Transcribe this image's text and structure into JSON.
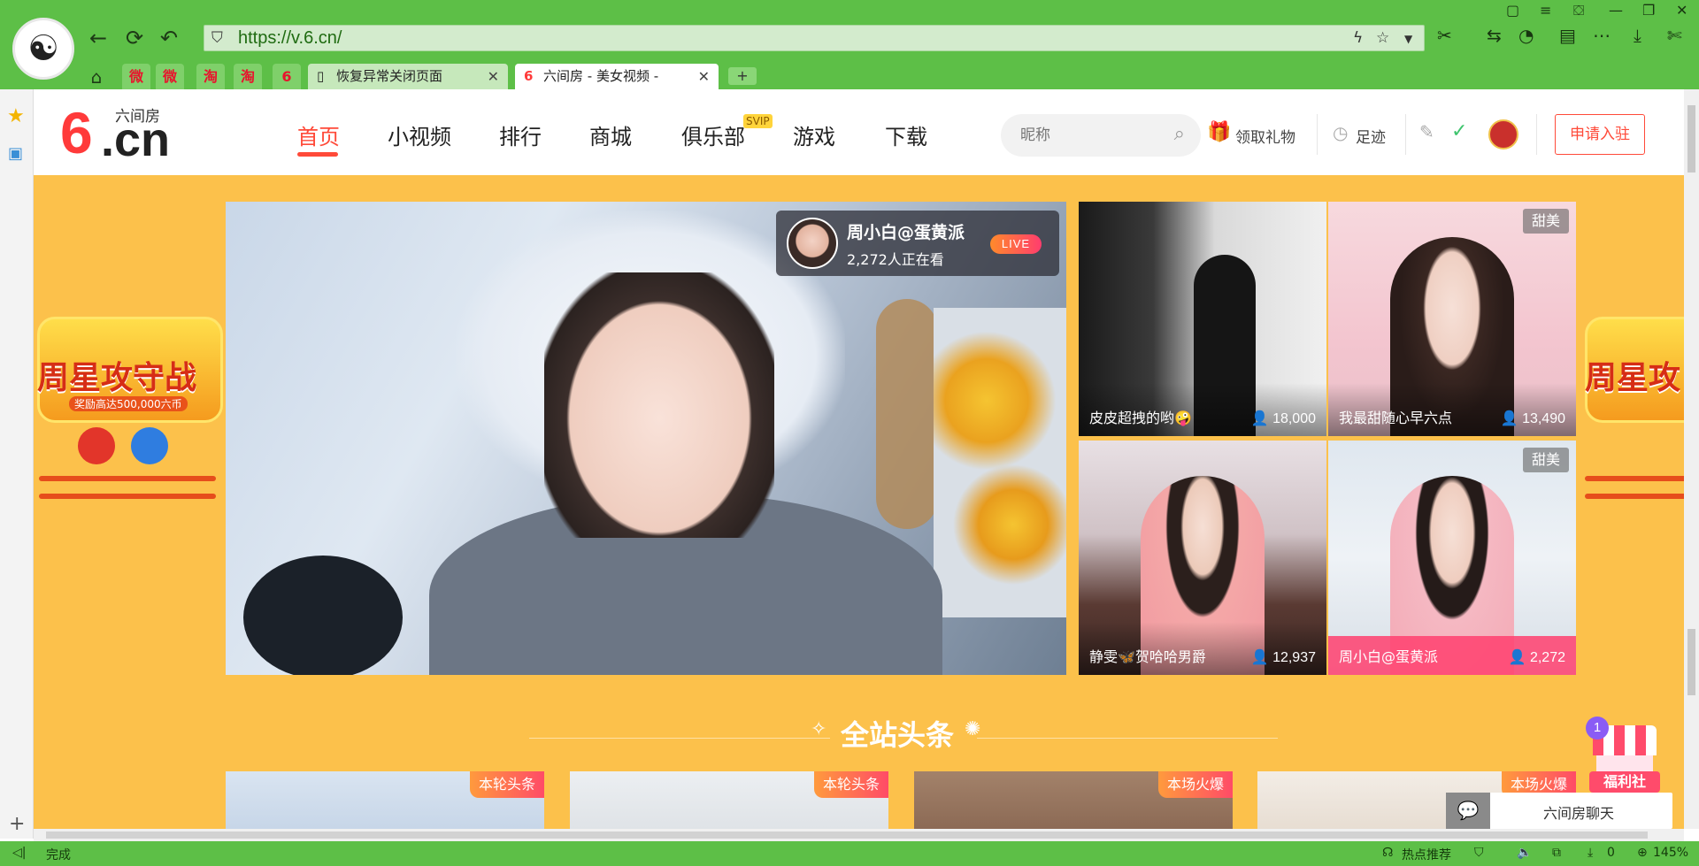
{
  "browser": {
    "url": "https://v.6.cn/",
    "tabs": [
      {
        "label": "恢复异常关闭页面"
      },
      {
        "label": "六间房 - 美女视频 - "
      }
    ],
    "small_tabs": [
      "微",
      "微",
      "淘",
      "淘",
      "6"
    ],
    "status_text": "完成",
    "status_right": {
      "hot": "热点推荐",
      "downloads": "0",
      "zoom": "145%"
    }
  },
  "site": {
    "brand_small": "六间房",
    "brand_six": "6",
    "brand_cn": ".cn",
    "nav": [
      {
        "label": "首页",
        "active": true
      },
      {
        "label": "小视频"
      },
      {
        "label": "排行"
      },
      {
        "label": "商城"
      },
      {
        "label": "俱乐部"
      },
      {
        "label": "游戏"
      },
      {
        "label": "下载"
      }
    ],
    "svip": "SVIP",
    "search_placeholder": "昵称",
    "gift_link": "领取礼物",
    "footprint_link": "足迹",
    "apply_button": "申请入驻"
  },
  "banner": {
    "left_title": "周星攻守战",
    "right_title": "周星攻",
    "left_sub": "奖励高达500,000六币"
  },
  "featured": {
    "name": "周小白@蛋黄派",
    "viewers": "2,272人正在看",
    "live": "LIVE"
  },
  "rooms": [
    {
      "name": "皮皮超拽的哟🤪",
      "count": "18,000",
      "tag": ""
    },
    {
      "name": "我最甜随心早六点",
      "count": "13,490",
      "tag": "甜美"
    },
    {
      "name": "静雯🦋贺哈哈男爵",
      "count": "12,937",
      "tag": ""
    },
    {
      "name": "周小白@蛋黄派",
      "count": "2,272",
      "tag": "甜美"
    }
  ],
  "section": {
    "title": "全站头条"
  },
  "feed": [
    {
      "badge": "本轮头条"
    },
    {
      "badge": "本轮头条"
    },
    {
      "badge": "本场火爆"
    },
    {
      "badge": "本场火爆"
    }
  ],
  "floats": {
    "gift_label": "福利社",
    "gift_badge": "1",
    "chat_label": "六间房聊天"
  }
}
